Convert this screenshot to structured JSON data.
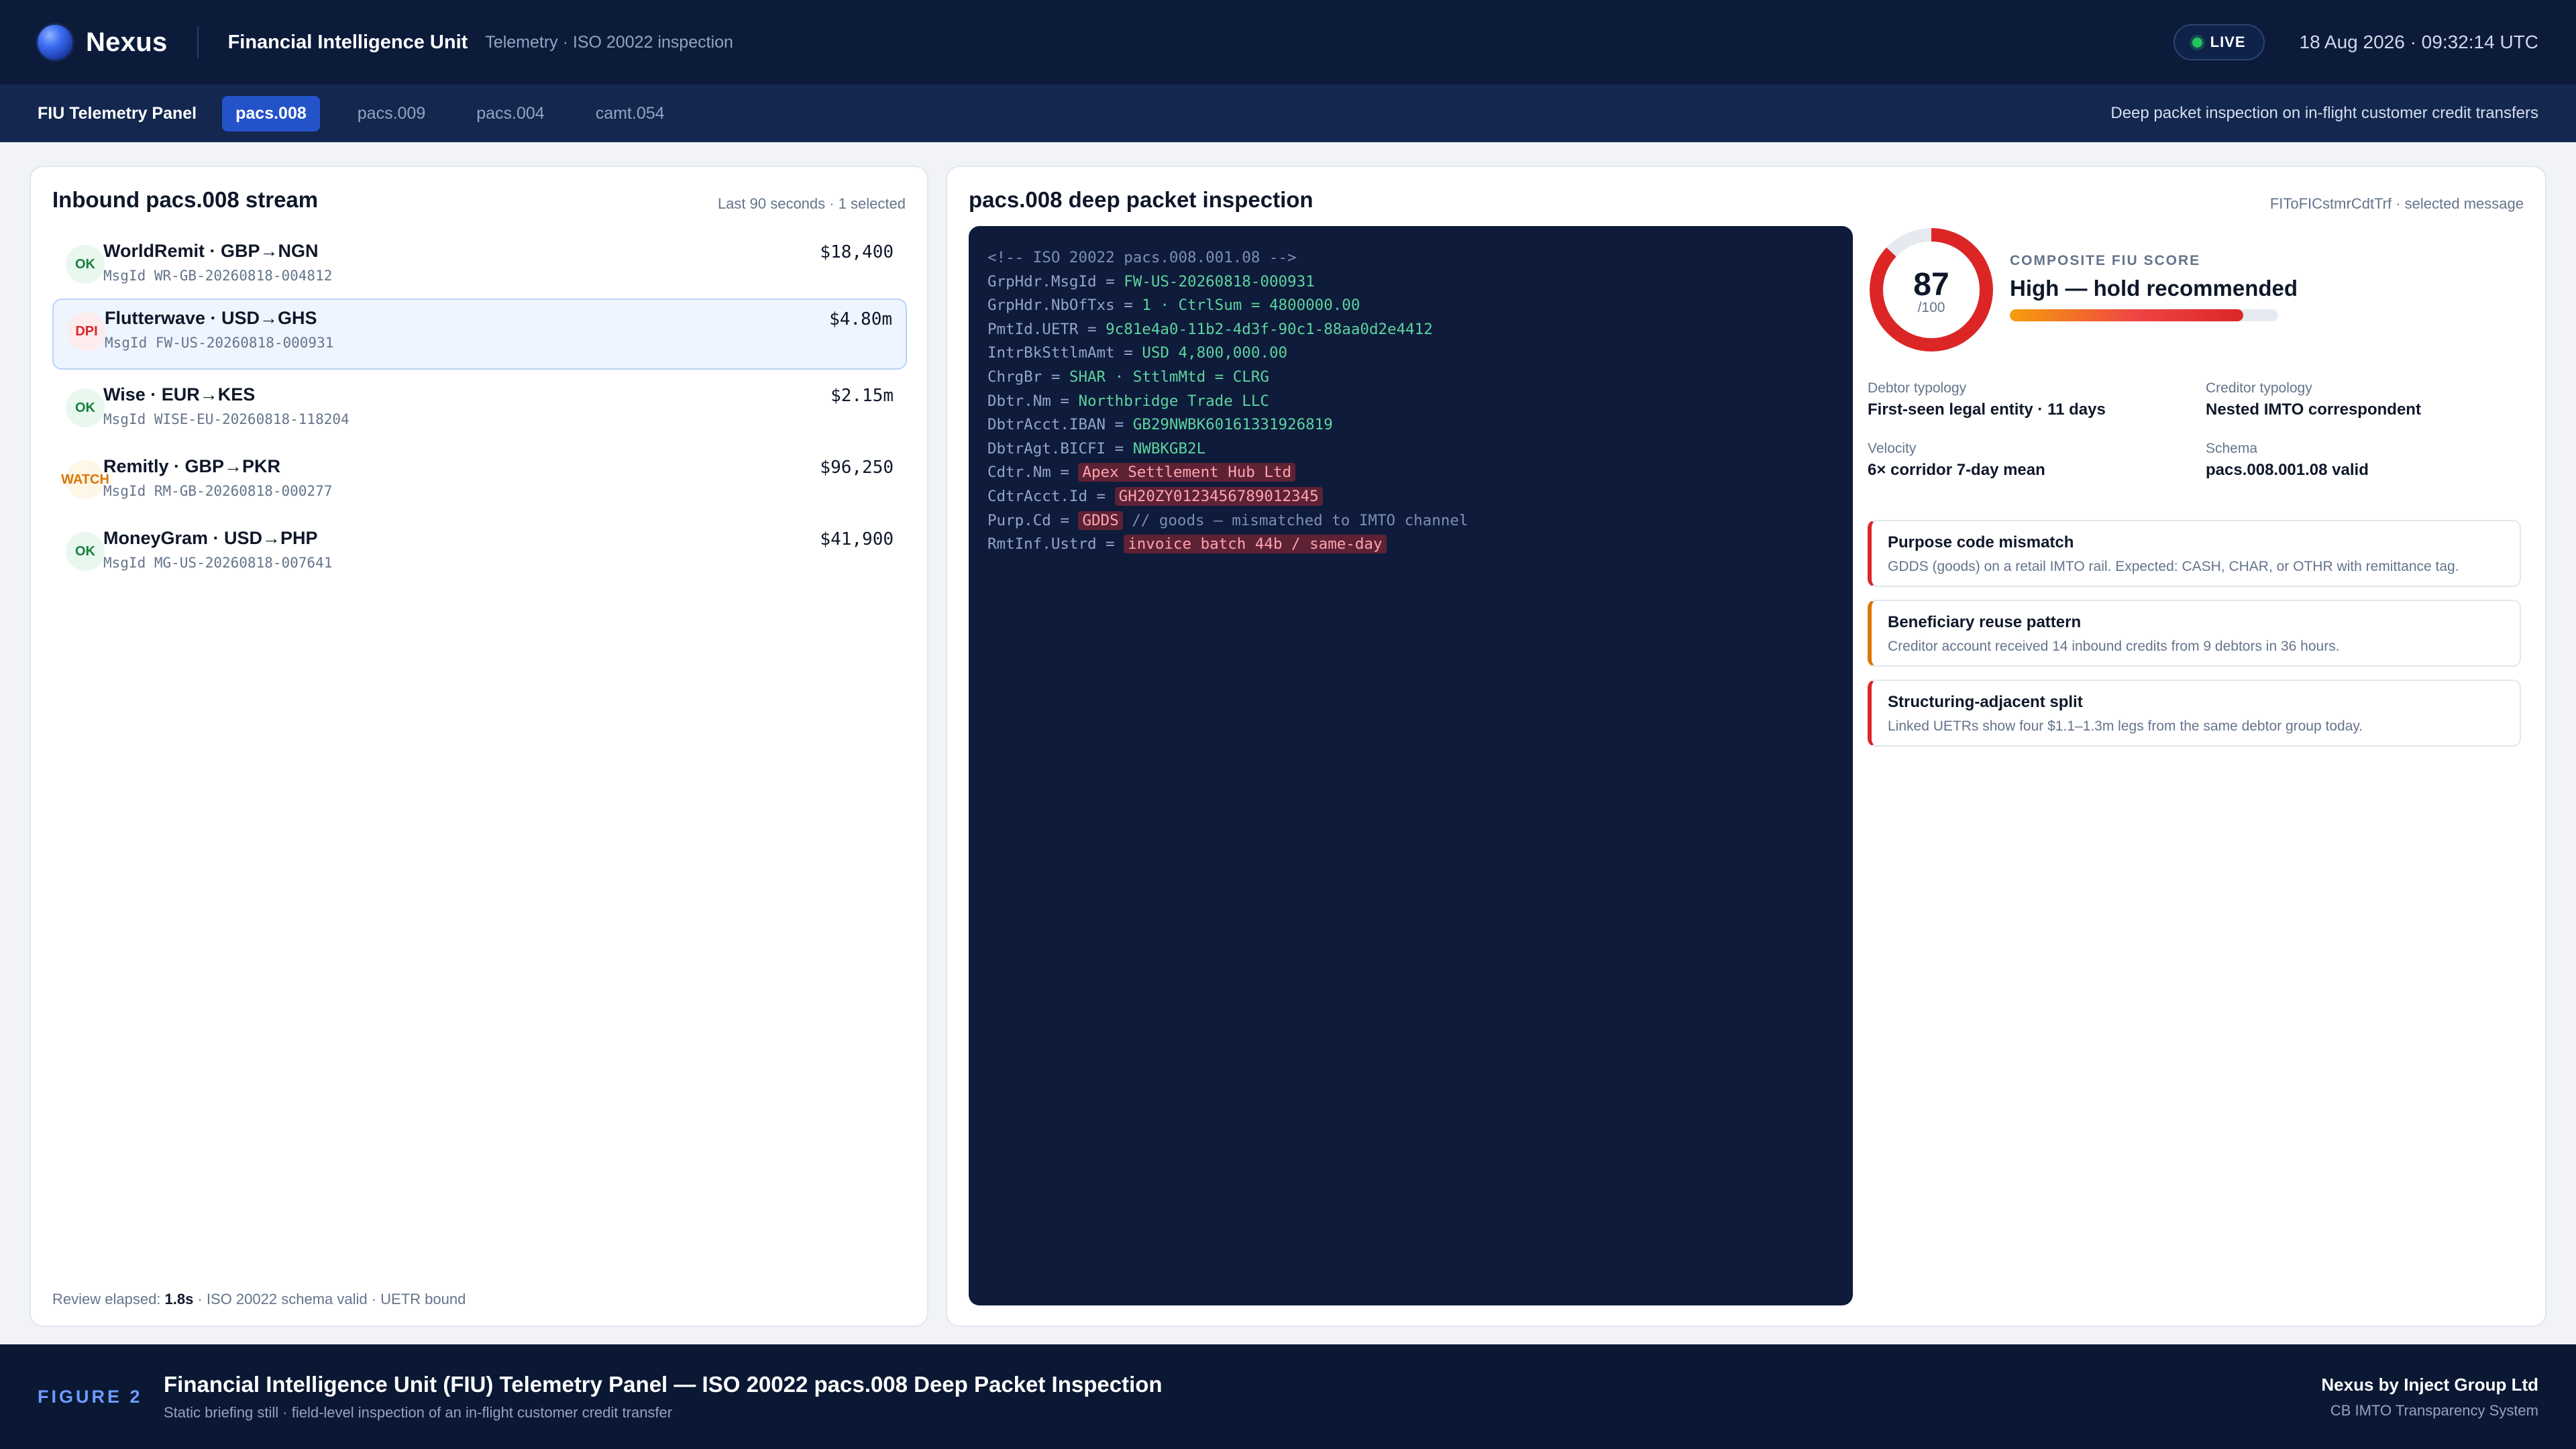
{
  "header": {
    "brand": "Nexus",
    "title": "Financial Intelligence Unit",
    "subtitle": "Telemetry · ISO 20022 inspection",
    "live_label": "LIVE",
    "timestamp": "18 Aug 2026 · 09:32:14 UTC"
  },
  "tabbar": {
    "panel_name": "FIU Telemetry Panel",
    "tabs": [
      {
        "label": "pacs.008",
        "active": true
      },
      {
        "label": "pacs.009",
        "active": false
      },
      {
        "label": "pacs.004",
        "active": false
      },
      {
        "label": "camt.054",
        "active": false
      }
    ],
    "description": "Deep packet inspection on in-flight customer credit transfers"
  },
  "stream": {
    "title": "Inbound pacs.008 stream",
    "meta": "Last 90 seconds · 1 selected",
    "rows": [
      {
        "badge": "OK",
        "status": "ok",
        "name": "WorldRemit · GBP→NGN",
        "msg": "MsgId WR-GB-20260818-004812",
        "amount": "$18,400",
        "selected": false
      },
      {
        "badge": "DPI",
        "status": "dpi",
        "name": "Flutterwave · USD→GHS",
        "msg": "MsgId FW-US-20260818-000931",
        "amount": "$4.80m",
        "selected": true
      },
      {
        "badge": "OK",
        "status": "ok",
        "name": "Wise · EUR→KES",
        "msg": "MsgId WISE-EU-20260818-118204",
        "amount": "$2.15m",
        "selected": false
      },
      {
        "badge": "WATCH",
        "status": "watch",
        "name": "Remitly · GBP→PKR",
        "msg": "MsgId RM-GB-20260818-000277",
        "amount": "$96,250",
        "selected": false
      },
      {
        "badge": "OK",
        "status": "ok",
        "name": "MoneyGram · USD→PHP",
        "msg": "MsgId MG-US-20260818-007641",
        "amount": "$41,900",
        "selected": false
      }
    ],
    "review_prefix": "Review elapsed: ",
    "review_time": "1.8s",
    "review_suffix": " · ISO 20022 schema valid · UETR bound"
  },
  "inspection": {
    "title": "pacs.008 deep packet inspection",
    "meta": "FIToFICstmrCdtTrf · selected message",
    "code": {
      "comment": "<!-- ISO 20022 pacs.008.001.08 -->",
      "l1k": "GrpHdr.MsgId = ",
      "l1v": "FW-US-20260818-000931",
      "l2k": "GrpHdr.NbOfTxs = ",
      "l2v": "1 · CtrlSum = 4800000.00",
      "l3k": "PmtId.UETR = ",
      "l3v": "9c81e4a0-11b2-4d3f-90c1-88aa0d2e4412",
      "l4k": "IntrBkSttlmAmt = ",
      "l4v": "USD 4,800,000.00",
      "l5k": "ChrgBr = ",
      "l5v": "SHAR · SttlmMtd = CLRG",
      "l6k": "Dbtr.Nm = ",
      "l6v": "Northbridge Trade LLC",
      "l7k": "DbtrAcct.IBAN = ",
      "l7v": "GB29NWBK60161331926819",
      "l8k": "DbtrAgt.BICFI = ",
      "l8v": "NWBKGB2L",
      "l9k": "Cdtr.Nm = ",
      "l9v": "Apex Settlement Hub Ltd",
      "l10k": "CdtrAcct.Id = ",
      "l10v": "GH20ZY0123456789012345",
      "l11k": "Purp.Cd = ",
      "l11v": "GDDS",
      "l11c": " // goods — mismatched to IMTO channel",
      "l12k": "RmtInf.Ustrd = ",
      "l12v": "invoice batch 44b / same-day"
    },
    "score": {
      "value": 87,
      "value_label": "87",
      "denominator": "/100",
      "label": "COMPOSITE FIU SCORE",
      "verdict": "High — hold recommended",
      "fraction": 0.87
    },
    "facts": [
      {
        "label": "Debtor typology",
        "value": "First-seen legal entity · 11 days"
      },
      {
        "label": "Creditor typology",
        "value": "Nested IMTO correspondent"
      },
      {
        "label": "Velocity",
        "value": "6× corridor 7-day mean"
      },
      {
        "label": "Schema",
        "value": "pacs.008.001.08 valid"
      }
    ],
    "alerts": [
      {
        "title": "Purpose code mismatch",
        "body": "GDDS (goods) on a retail IMTO rail. Expected: CASH, CHAR, or OTHR with remittance tag.",
        "severity": "high"
      },
      {
        "title": "Beneficiary reuse pattern",
        "body": "Creditor account received 14 inbound credits from 9 debtors in 36 hours.",
        "severity": "medium"
      },
      {
        "title": "Structuring-adjacent split",
        "body": "Linked UETRs show four $1.1–1.3m legs from the same debtor group today.",
        "severity": "high"
      }
    ]
  },
  "footer": {
    "figure": "FIGURE 2",
    "title": "Financial Intelligence Unit (FIU) Telemetry Panel — ISO 20022 pacs.008 Deep Packet Inspection",
    "subtitle": "Static briefing still · field-level inspection of an in-flight customer credit transfer",
    "brand": "Nexus by Inject Group Ltd",
    "system": "CB IMTO Transparency System"
  },
  "colors": {
    "header_bg": "#0c1b3a",
    "tab_active": "#2453c9",
    "ok": "#15803d",
    "dpi": "#dc2626",
    "watch": "#d97706",
    "score_ring": "#dc2626"
  },
  "icons": {
    "brand": "nexus-orb-icon",
    "live": "live-dot-icon"
  }
}
